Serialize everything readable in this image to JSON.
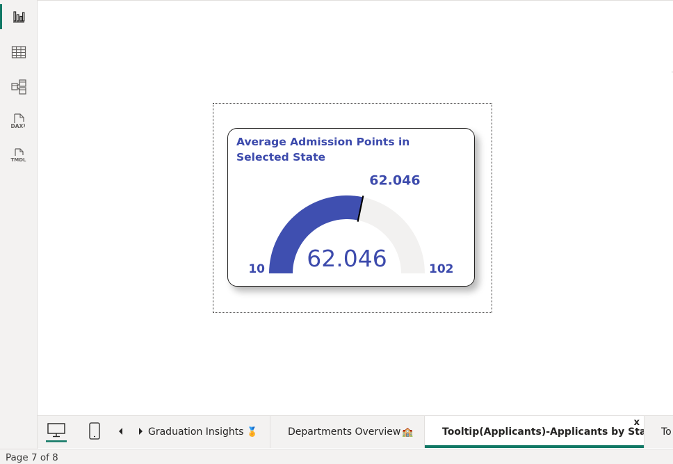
{
  "left_rail": {
    "items": [
      {
        "name": "report-view-icon",
        "active": true
      },
      {
        "name": "table-view-icon",
        "active": false
      },
      {
        "name": "model-view-icon",
        "active": false
      },
      {
        "name": "dax-query-view-icon",
        "label": "DAX",
        "active": false
      },
      {
        "name": "tmdl-view-icon",
        "label": "TMDL",
        "active": false
      }
    ]
  },
  "visual": {
    "title": "Average Admission Points in Selected State",
    "chart_data": {
      "type": "gauge",
      "min": 10,
      "max": 102,
      "value": 62.046,
      "target": 62.046,
      "min_label": "10",
      "max_label": "102",
      "value_label": "62.046",
      "target_label": "62.046",
      "fill_color": "#3f4fb0",
      "track_color": "#f2f1f0",
      "label_color": "#3c4aac"
    }
  },
  "tabbar": {
    "tabs": [
      {
        "label": "Graduation Insights",
        "emoji": "🏅",
        "active": false
      },
      {
        "label": "Departments Overview",
        "emoji": "🏫",
        "active": false
      },
      {
        "label": "Tooltip(Applicants)-Applicants by State",
        "active": true,
        "close": "x"
      },
      {
        "label": "To",
        "active": false
      }
    ]
  },
  "status": {
    "page_text": "Page 7 of 8"
  }
}
